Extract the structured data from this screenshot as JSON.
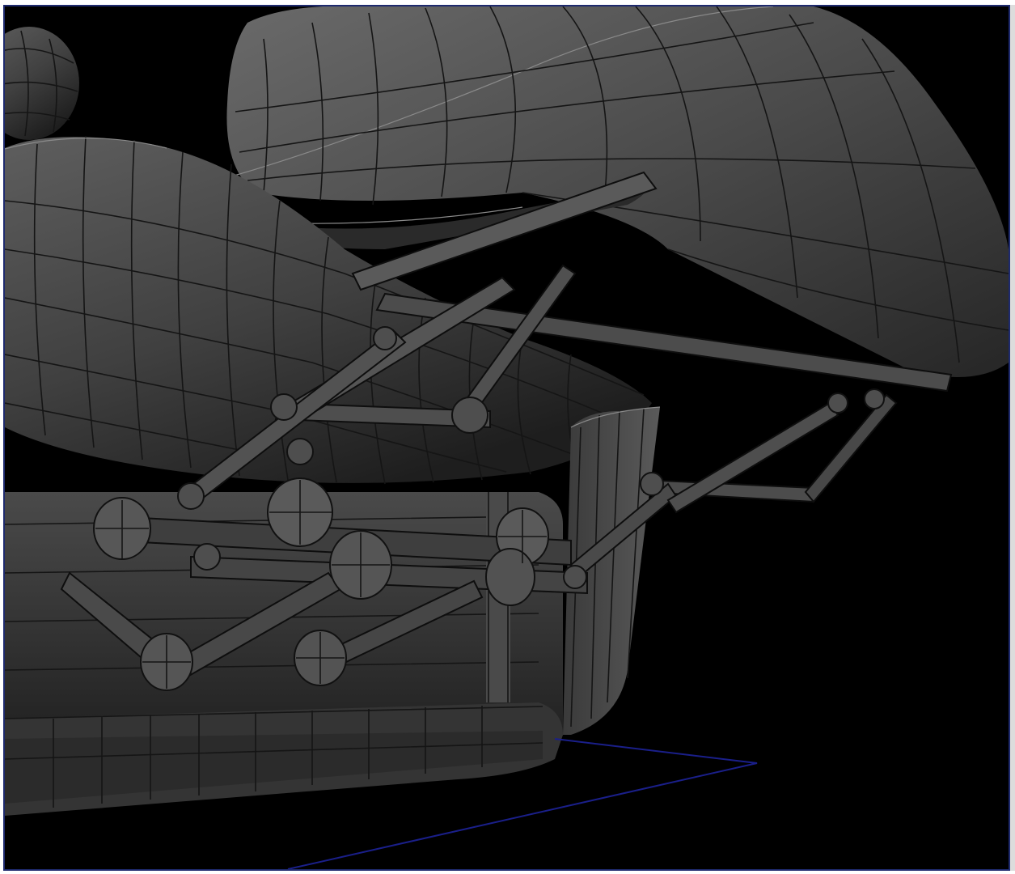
{
  "viewport": {
    "background": "#000000",
    "border_color": "#1e2a6e",
    "mesh_color": "#555555",
    "wire_color": "#151515",
    "ground_line_color": "#1a1f8a"
  }
}
